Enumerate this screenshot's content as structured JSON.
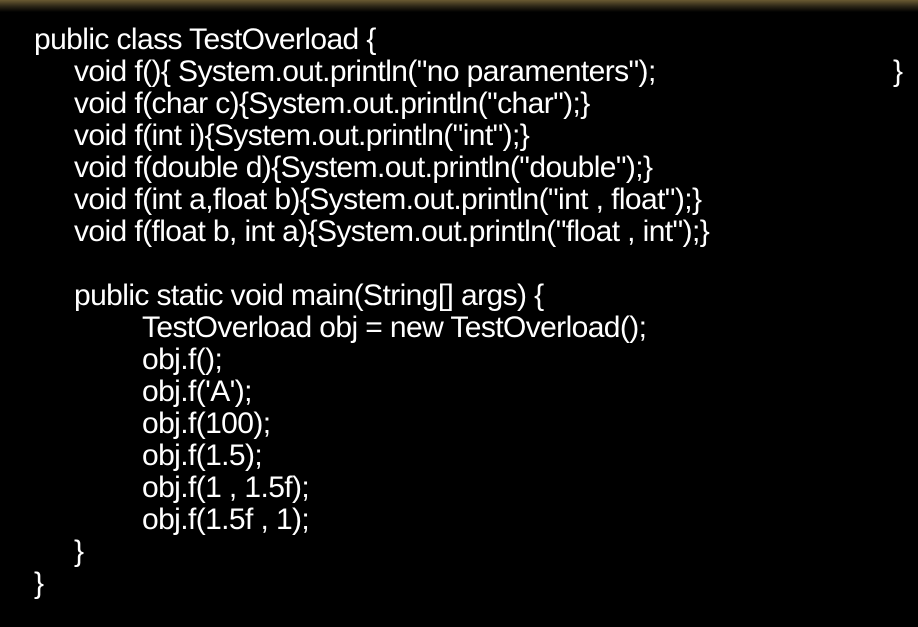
{
  "code": {
    "lines": [
      "public class TestOverload {",
      "void f(){ System.out.println(\"no paramenters\");",
      "void f(char c){System.out.println(\"char\");}",
      "void f(int i){System.out.println(\"int\");}",
      "void f(double d){System.out.println(\"double\");}",
      "void f(int a,float b){System.out.println(\"int , float\");}",
      "void f(float b, int a){System.out.println(\"float , int\");}",
      "public static void main(String[] args) {",
      "TestOverload obj = new TestOverload();",
      "obj.f();",
      "obj.f('A');",
      "obj.f(100);",
      "obj.f(1.5);",
      "obj.f(1 , 1.5f);",
      "obj.f(1.5f , 1);",
      "}",
      "}"
    ],
    "line1_trailing_brace": "}"
  }
}
